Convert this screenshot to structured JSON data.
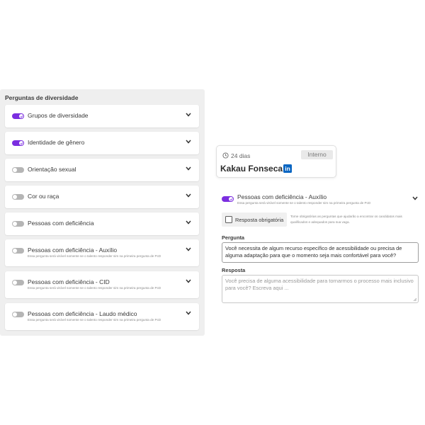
{
  "left_panel": {
    "title": "Perguntas de diversidade",
    "items": [
      {
        "label": "Grupos de diversidade",
        "enabled": true,
        "subtitle": ""
      },
      {
        "label": "Identidade de gênero",
        "enabled": true,
        "subtitle": ""
      },
      {
        "label": "Orientação sexual",
        "enabled": false,
        "subtitle": ""
      },
      {
        "label": "Cor ou raça",
        "enabled": false,
        "subtitle": ""
      },
      {
        "label": "Pessoas com deficiência",
        "enabled": false,
        "subtitle": ""
      },
      {
        "label": "Pessoas com deficiência - Auxílio",
        "enabled": false,
        "subtitle": "Essa pergunta será visível somente se o talento responder sim na primeira pergunta de PcD"
      },
      {
        "label": "Pessoas com deficiência - CID",
        "enabled": false,
        "subtitle": "Essa pergunta será visível somente se o talento responder sim na primeira pergunta de PcD"
      },
      {
        "label": "Pessoas com deficiência - Laudo médico",
        "enabled": false,
        "subtitle": "Essa pergunta será visível somente se o talento responder sim na primeira pergunta de PcD"
      }
    ]
  },
  "candidate": {
    "days": "24 dias",
    "badge": "Interno",
    "name": "Kakau Fonseca",
    "linkedin_glyph": "in"
  },
  "detail": {
    "title": "Pessoas com deficiência - Auxílio",
    "enabled": true,
    "subtitle": "Essa pergunta será visível somente se o talento responder sim na primeira pergunta de PcD",
    "required_label": "Resposta obrigatória",
    "required_checked": false,
    "required_note": "Torne obrigatórias as perguntas que ajudarão a encontrar os candidatos mais qualificados e adequados para sua vaga.",
    "question_label": "Pergunta",
    "question_value": "Você necessita de algum recurso específico de acessibilidade ou precisa de alguma adaptação para que o momento seja mais confortável para você?",
    "answer_label": "Resposta",
    "answer_placeholder": "Você precisa de alguma acessibilidade para tornarmos o processo mais inclusivo para você? Escreva aqui ..."
  },
  "colors": {
    "accent": "#7b2ee0",
    "toggle_off": "#b5b5b5",
    "panel_bg": "#efefef",
    "linkedin": "#0a66c2"
  }
}
